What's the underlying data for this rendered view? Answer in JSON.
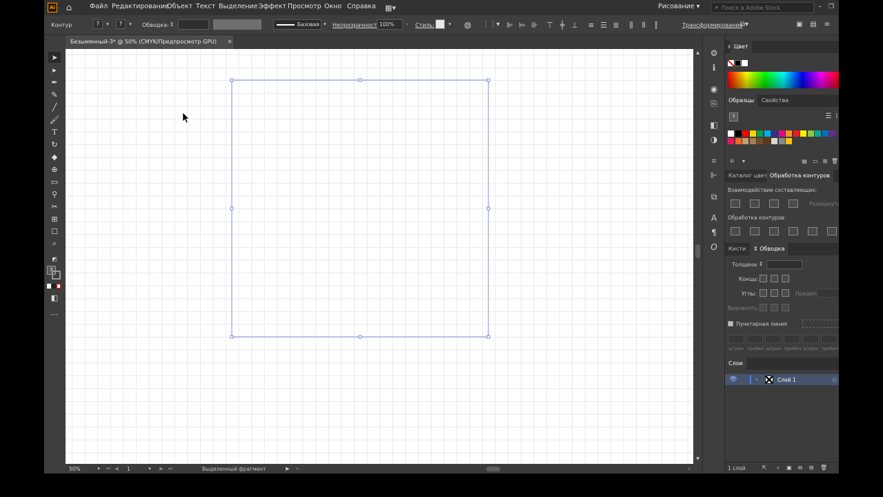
{
  "app": {
    "logo": "Ai"
  },
  "menu": {
    "items": [
      "Файл",
      "Редактирование",
      "Объект",
      "Текст",
      "Выделение",
      "Эффект",
      "Просмотр",
      "Окно",
      "Справка"
    ],
    "workspace": "Рисование",
    "search_placeholder": "Поиск в Adobe Stock"
  },
  "control": {
    "kontur": "Контур",
    "stroke_label": "Обводка:",
    "stroke_style": "Базовая",
    "opacity_label": "Непрозрачность:",
    "opacity_value": "100%",
    "style_label": "Стиль:",
    "transform_label": "Трансформирование"
  },
  "document": {
    "tab_title": "Безымянный-3* @ 50% (CMYK/Предпросмотр GPU)"
  },
  "status": {
    "zoom": "50%",
    "artboard": "1",
    "selection_text": "Выделенный фрагмент"
  },
  "color_panel": {
    "title": "Цвет"
  },
  "swatches_panel": {
    "tabs": [
      "Образцы",
      "Свойства"
    ],
    "colors": [
      "#ffffff",
      "#000000",
      "#ff0000",
      "#ffd400",
      "#00a651",
      "#00aeef",
      "#2e3192",
      "#ec008c",
      "#f7941d",
      "#ed1c24",
      "#fff200",
      "#8dc63f",
      "#00a99d",
      "#0072bc",
      "#662d91",
      "#ed145b",
      "#f26522",
      "#c69c6d",
      "#a67c52",
      "#754c24",
      "#603913",
      "#d7d7d7",
      "#898989",
      "#ffc20e"
    ]
  },
  "pathfinder_panel": {
    "tabs": [
      "Каталог цвето",
      "Обработка контуров"
    ],
    "shape_modes": "Взаимодействие составляющих:",
    "expand": "Развернуть",
    "pathfinders": "Обработка контуров:"
  },
  "stroke_panel": {
    "tabs": [
      "Кисти",
      "Обводка"
    ],
    "weight": "Толщина:",
    "caps": "Концы:",
    "corners": "Углы:",
    "limit": "Предел:",
    "align": "Выровнять:",
    "dashed": "Пунктирная линия",
    "dash_labels": [
      "штрих",
      "пробел",
      "штрих",
      "пробел",
      "штрих",
      "пробел"
    ]
  },
  "layers_panel": {
    "title": "Слои",
    "layer_name": "Слой 1",
    "footer": "1 слой"
  }
}
